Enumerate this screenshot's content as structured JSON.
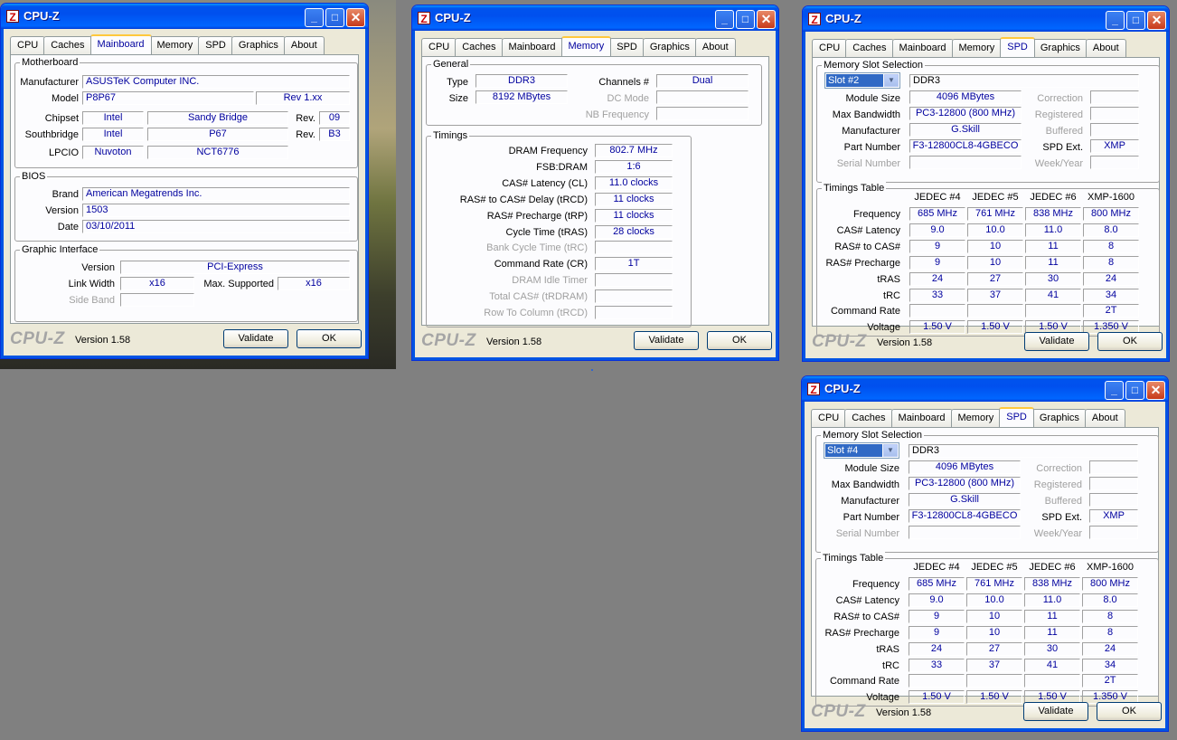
{
  "app_title": "CPU-Z",
  "tabs": [
    "CPU",
    "Caches",
    "Mainboard",
    "Memory",
    "SPD",
    "Graphics",
    "About"
  ],
  "footer": {
    "logo": "CPU-Z",
    "version": "Version 1.58",
    "validate": "Validate",
    "ok": "OK"
  },
  "mainboard": {
    "motherboard_title": "Motherboard",
    "manufacturer_label": "Manufacturer",
    "manufacturer": "ASUSTeK Computer INC.",
    "model_label": "Model",
    "model": "P8P67",
    "model_rev": "Rev 1.xx",
    "chipset_label": "Chipset",
    "chipset_vendor": "Intel",
    "chipset_name": "Sandy Bridge",
    "chipset_rev_label": "Rev.",
    "chipset_rev": "09",
    "southbridge_label": "Southbridge",
    "sb_vendor": "Intel",
    "sb_name": "P67",
    "sb_rev_label": "Rev.",
    "sb_rev": "B3",
    "lpcio_label": "LPCIO",
    "lpcio_vendor": "Nuvoton",
    "lpcio_name": "NCT6776",
    "bios_title": "BIOS",
    "brand_label": "Brand",
    "brand": "American Megatrends Inc.",
    "version_label": "Version",
    "version": "1503",
    "date_label": "Date",
    "date": "03/10/2011",
    "gi_title": "Graphic Interface",
    "gi_version_label": "Version",
    "gi_version": "PCI-Express",
    "link_width_label": "Link Width",
    "link_width": "x16",
    "max_supported_label": "Max. Supported",
    "max_supported": "x16",
    "side_band_label": "Side Band"
  },
  "memory": {
    "general_title": "General",
    "type_label": "Type",
    "type": "DDR3",
    "size_label": "Size",
    "size": "8192 MBytes",
    "channels_label": "Channels #",
    "channels": "Dual",
    "dc_mode_label": "DC Mode",
    "nb_freq_label": "NB Frequency",
    "timings_title": "Timings",
    "rows": [
      {
        "label": "DRAM Frequency",
        "value": "802.7 MHz",
        "enabled": true
      },
      {
        "label": "FSB:DRAM",
        "value": "1:6",
        "enabled": true
      },
      {
        "label": "CAS# Latency (CL)",
        "value": "11.0 clocks",
        "enabled": true
      },
      {
        "label": "RAS# to CAS# Delay (tRCD)",
        "value": "11 clocks",
        "enabled": true
      },
      {
        "label": "RAS# Precharge (tRP)",
        "value": "11 clocks",
        "enabled": true
      },
      {
        "label": "Cycle Time (tRAS)",
        "value": "28 clocks",
        "enabled": true
      },
      {
        "label": "Bank Cycle Time (tRC)",
        "value": "",
        "enabled": false
      },
      {
        "label": "Command Rate (CR)",
        "value": "1T",
        "enabled": true
      },
      {
        "label": "DRAM Idle Timer",
        "value": "",
        "enabled": false
      },
      {
        "label": "Total CAS# (tRDRAM)",
        "value": "",
        "enabled": false
      },
      {
        "label": "Row To Column (tRCD)",
        "value": "",
        "enabled": false
      }
    ]
  },
  "spd_labels": {
    "slot_group": "Memory Slot Selection",
    "module_size": "Module Size",
    "max_bandwidth": "Max Bandwidth",
    "manufacturer": "Manufacturer",
    "part_number": "Part Number",
    "serial_number": "Serial Number",
    "correction": "Correction",
    "registered": "Registered",
    "buffered": "Buffered",
    "spd_ext": "SPD Ext.",
    "week_year": "Week/Year",
    "timings_table": "Timings Table",
    "col_headers": [
      "JEDEC #4",
      "JEDEC #5",
      "JEDEC #6",
      "XMP-1600"
    ],
    "row_labels": [
      "Frequency",
      "CAS# Latency",
      "RAS# to CAS#",
      "RAS# Precharge",
      "tRAS",
      "tRC",
      "Command Rate",
      "Voltage"
    ]
  },
  "spd_windows": [
    {
      "slot": "Slot #2",
      "type": "DDR3",
      "module_size": "4096 MBytes",
      "max_bandwidth": "PC3-12800 (800 MHz)",
      "manufacturer": "G.Skill",
      "part_number": "F3-12800CL8-4GBECO",
      "spd_ext": "XMP",
      "table": [
        [
          "685 MHz",
          "761 MHz",
          "838 MHz",
          "800 MHz"
        ],
        [
          "9.0",
          "10.0",
          "11.0",
          "8.0"
        ],
        [
          "9",
          "10",
          "11",
          "8"
        ],
        [
          "9",
          "10",
          "11",
          "8"
        ],
        [
          "24",
          "27",
          "30",
          "24"
        ],
        [
          "33",
          "37",
          "41",
          "34"
        ],
        [
          "",
          "",
          "",
          "2T"
        ],
        [
          "1.50 V",
          "1.50 V",
          "1.50 V",
          "1.350 V"
        ]
      ]
    },
    {
      "slot": "Slot #4",
      "type": "DDR3",
      "module_size": "4096 MBytes",
      "max_bandwidth": "PC3-12800 (800 MHz)",
      "manufacturer": "G.Skill",
      "part_number": "F3-12800CL8-4GBECO",
      "spd_ext": "XMP",
      "table": [
        [
          "685 MHz",
          "761 MHz",
          "838 MHz",
          "800 MHz"
        ],
        [
          "9.0",
          "10.0",
          "11.0",
          "8.0"
        ],
        [
          "9",
          "10",
          "11",
          "8"
        ],
        [
          "9",
          "10",
          "11",
          "8"
        ],
        [
          "24",
          "27",
          "30",
          "24"
        ],
        [
          "33",
          "37",
          "41",
          "34"
        ],
        [
          "",
          "",
          "",
          "2T"
        ],
        [
          "1.50 V",
          "1.50 V",
          "1.50 V",
          "1.350 V"
        ]
      ]
    }
  ]
}
